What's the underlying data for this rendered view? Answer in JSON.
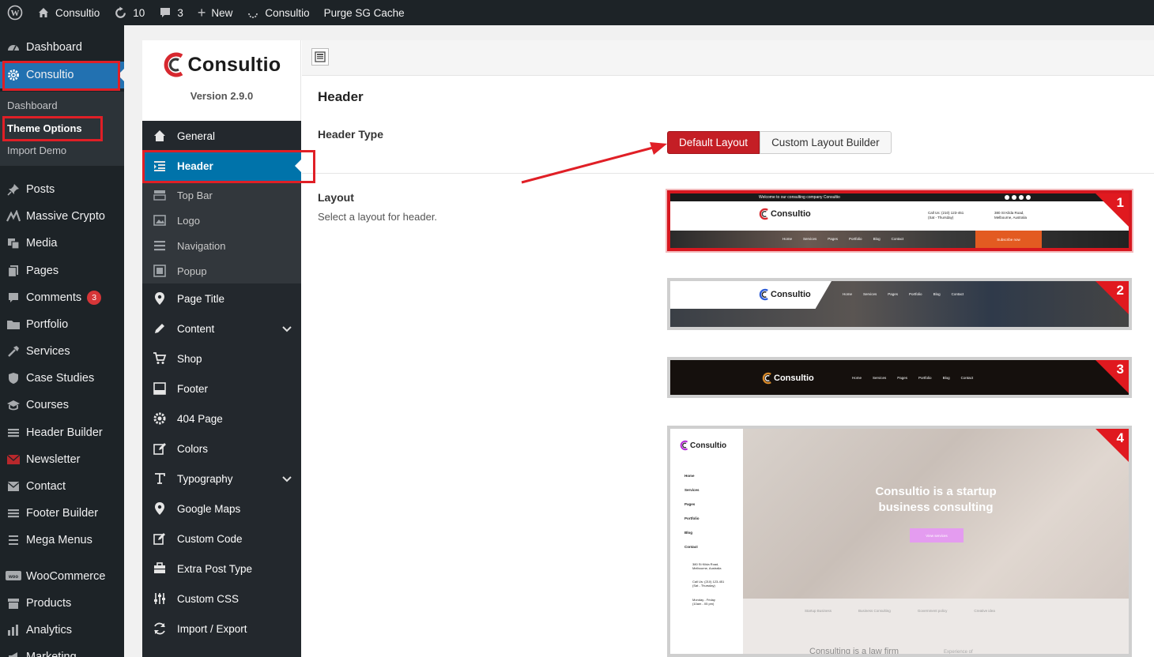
{
  "admin_bar": {
    "site_name": "Consultio",
    "updates_count": "10",
    "comments_count": "3",
    "new_label": "New",
    "theme_label": "Consultio",
    "purge_label": "Purge SG Cache"
  },
  "admin_menu": {
    "items_top": [
      {
        "label": "Dashboard",
        "icon": "dashboard-icon"
      },
      {
        "label": "Consultio",
        "icon": "gear-icon"
      }
    ],
    "consultio_submenu": [
      "Dashboard",
      "Theme Options",
      "Import Demo"
    ],
    "items": [
      {
        "label": "Posts",
        "icon": "pin-icon"
      },
      {
        "label": "Massive Crypto",
        "icon": "chart-icon"
      },
      {
        "label": "Media",
        "icon": "media-icon"
      },
      {
        "label": "Pages",
        "icon": "pages-icon"
      },
      {
        "label": "Comments",
        "icon": "comment-icon",
        "badge": "3"
      },
      {
        "label": "Portfolio",
        "icon": "folder-icon"
      },
      {
        "label": "Services",
        "icon": "hammer-icon"
      },
      {
        "label": "Case Studies",
        "icon": "shield-icon"
      },
      {
        "label": "Courses",
        "icon": "graduation-icon"
      },
      {
        "label": "Header Builder",
        "icon": "list-icon"
      },
      {
        "label": "Newsletter",
        "icon": "envelope-icon"
      },
      {
        "label": "Contact",
        "icon": "mail-icon"
      },
      {
        "label": "Footer Builder",
        "icon": "list-icon"
      },
      {
        "label": "Mega Menus",
        "icon": "menu-icon"
      },
      {
        "label": "WooCommerce",
        "icon": "woo-icon"
      },
      {
        "label": "Products",
        "icon": "archive-icon"
      },
      {
        "label": "Analytics",
        "icon": "bar-chart-icon"
      },
      {
        "label": "Marketing",
        "icon": "megaphone-icon"
      }
    ]
  },
  "panel": {
    "logo_text": "Consultio",
    "version": "Version 2.9.0",
    "nav": [
      {
        "label": "General",
        "icon": "home-icon"
      },
      {
        "label": "Header",
        "icon": "header-icon"
      },
      {
        "label": "Top Bar",
        "icon": "topbar-icon"
      },
      {
        "label": "Logo",
        "icon": "image-icon"
      },
      {
        "label": "Navigation",
        "icon": "menu-icon"
      },
      {
        "label": "Popup",
        "icon": "popup-icon"
      },
      {
        "label": "Page Title",
        "icon": "location-icon"
      },
      {
        "label": "Content",
        "icon": "pencil-icon"
      },
      {
        "label": "Shop",
        "icon": "cart-icon"
      },
      {
        "label": "Footer",
        "icon": "footer-icon"
      },
      {
        "label": "404 Page",
        "icon": "cog-icon"
      },
      {
        "label": "Colors",
        "icon": "edit-icon"
      },
      {
        "label": "Typography",
        "icon": "text-icon"
      },
      {
        "label": "Google Maps",
        "icon": "location-icon"
      },
      {
        "label": "Custom Code",
        "icon": "code-edit-icon"
      },
      {
        "label": "Extra Post Type",
        "icon": "briefcase-icon"
      },
      {
        "label": "Custom CSS",
        "icon": "sliders-icon"
      },
      {
        "label": "Import / Export",
        "icon": "refresh-icon"
      }
    ],
    "section_title": "Header",
    "header_type_label": "Header Type",
    "header_type_options": [
      "Default Layout",
      "Custom Layout Builder"
    ],
    "header_type_selected": "Default Layout",
    "layout_label": "Layout",
    "layout_desc": "Select a layout for header.",
    "layouts": [
      {
        "number": "1",
        "selected": true
      },
      {
        "number": "2",
        "selected": false
      },
      {
        "number": "3",
        "selected": false
      },
      {
        "number": "4",
        "selected": false
      }
    ],
    "preview_texts": {
      "topbar": "Welcome to our consulting company Consultio",
      "call": "Call Us: (210) 123-451",
      "call_sub": "(Sat - Thursday)",
      "address": "380 St Kilda Road,",
      "address_sub": "Melbourne, Australia",
      "menu": [
        "Home",
        "Services",
        "Pages",
        "Portfolio",
        "Blog",
        "Contact"
      ],
      "subscribe": "Subscribe now",
      "hero": "Consultio is a startup business consulting",
      "view_services": "View services",
      "hours": "Monday - Friday",
      "hours_sub": "(10am - 05 pm)",
      "features": [
        "Startup Business",
        "Business Consulting",
        "Government policy",
        "Creative idea"
      ],
      "bottom": "Consulting is a law firm",
      "bottom2": "Experience of"
    }
  },
  "colors": {
    "accent": "#c41e25",
    "wp_blue": "#2271b1",
    "highlight": "#e01f26"
  }
}
